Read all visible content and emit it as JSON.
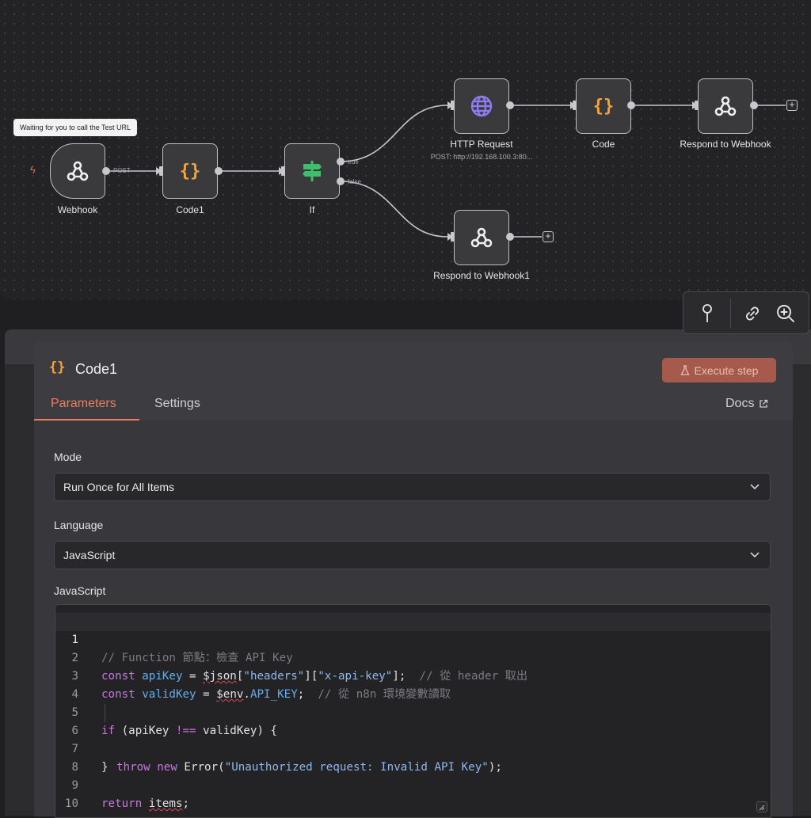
{
  "canvas": {
    "trigger_tooltip": "Waiting for you to call the Test URL",
    "nodes": {
      "webhook": {
        "label": "Webhook"
      },
      "code1": {
        "label": "Code1"
      },
      "if": {
        "label": "If"
      },
      "http_request": {
        "label": "HTTP Request",
        "subtitle": "POST: http://192.168.100.3:80..."
      },
      "code": {
        "label": "Code"
      },
      "respond_webhook": {
        "label": "Respond to Webhook"
      },
      "respond_webhook1": {
        "label": "Respond to Webhook1"
      }
    },
    "edge_labels": {
      "post": "POST",
      "true": "true",
      "false": "false"
    },
    "add_button": "+"
  },
  "toolbar": {
    "icons": [
      "pin-icon",
      "link-icon",
      "zoom-in-icon"
    ]
  },
  "panel": {
    "title_icon": "{}",
    "title": "Code1",
    "execute_label": "Execute step",
    "tabs": [
      {
        "label": "Parameters",
        "active": true
      },
      {
        "label": "Settings",
        "active": false
      }
    ],
    "docs_label": "Docs",
    "fields": {
      "mode": {
        "label": "Mode",
        "value": "Run Once for All Items"
      },
      "language": {
        "label": "Language",
        "value": "JavaScript"
      },
      "code_label": "JavaScript"
    },
    "code": {
      "line_numbers": [
        "1",
        "2",
        "3",
        "4",
        "5",
        "6",
        "7",
        "8",
        "9",
        "10"
      ],
      "l1_comment": "// Function 節點：檢查 API Key",
      "l2": {
        "kw": "const",
        "var": "apiKey",
        "op": " = ",
        "fn": "$json",
        "b1": "[",
        "s1": "\"headers\"",
        "b2": "][",
        "s2": "\"x-api-key\"",
        "end": "];",
        "comment": "// 從 header 取出"
      },
      "l3": {
        "kw": "const",
        "var": "validKey",
        "op": " = ",
        "env": "$env",
        "dot": ".",
        "prop": "API_KEY",
        "end": ";",
        "comment": "// 從 n8n 環境變數讀取"
      },
      "l5": {
        "kw": "if",
        "rest_a": " (apiKey ",
        "op": "!==",
        "rest_b": " validKey) {"
      },
      "l6": {
        "kw1": "throw",
        "kw2": "new",
        "cls": " Error(",
        "str": "\"Unauthorized request: Invalid API Key\"",
        "end": ");"
      },
      "l7": "}",
      "l9": {
        "kw": "return",
        "var": "items",
        "end": ";"
      }
    }
  },
  "colors": {
    "accent": "#ef7c5d",
    "code_icon": "#f6a23a",
    "if_icon": "#3fbf6a",
    "http_icon": "#8f7bf0"
  }
}
